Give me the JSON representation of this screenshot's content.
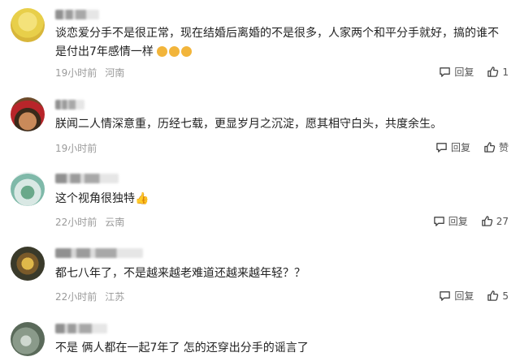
{
  "comments": [
    {
      "text": "谈恋爱分手不是很正常，现在结婚后离婚的不是很多，人家两个和平分手就好，搞的谁不是付出7年感情一样",
      "time": "19小时前",
      "location": "河南",
      "reply": "回复",
      "likes": "1"
    },
    {
      "text": "朕闻二人情深意重，历经七载，更显岁月之沉淀，愿其相守白头，共度余生。",
      "time": "19小时前",
      "location": "",
      "reply": "回复",
      "likes": "赞"
    },
    {
      "text": "这个视角很独特",
      "time": "22小时前",
      "location": "云南",
      "reply": "回复",
      "likes": "27"
    },
    {
      "text": "都七八年了，不是越来越老难道还越来越年轻？？",
      "time": "22小时前",
      "location": "江苏",
      "reply": "回复",
      "likes": "5"
    },
    {
      "text": "不是 俩人都在一起7年了 怎的还穿出分手的谣言了",
      "time": "",
      "location": "",
      "reply": "",
      "likes": ""
    }
  ]
}
